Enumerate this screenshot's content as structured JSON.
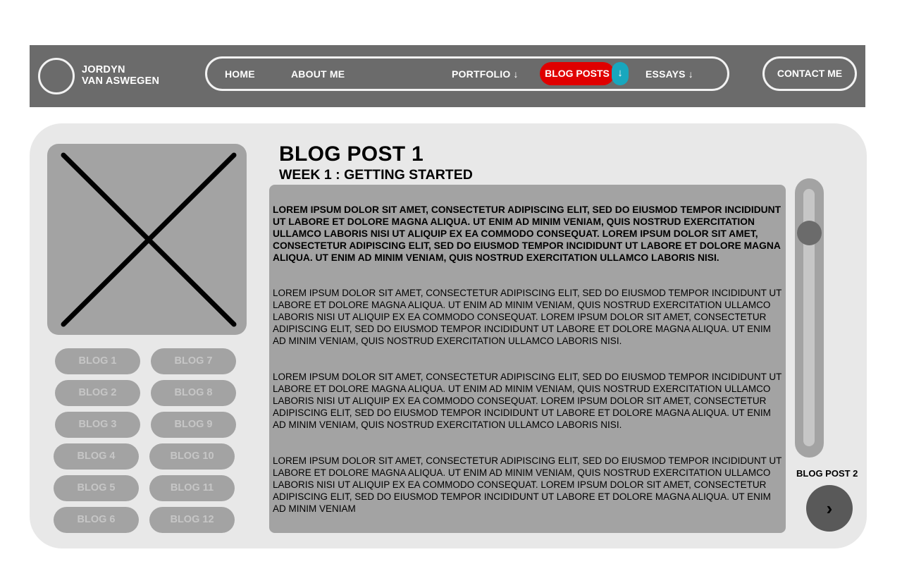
{
  "brand": {
    "line1": "JORDYN",
    "line2": "VAN ASWEGEN"
  },
  "nav": {
    "home": "HOME",
    "about": "ABOUT ME",
    "portfolio": "PORTFOLIO ↓",
    "blog_posts": "BLOG POSTS",
    "blog_posts_arrow": "↓",
    "essays": "ESSAYS ↓",
    "contact": "CONTACT ME"
  },
  "colors": {
    "nav_bg": "#6b6b6b",
    "active_nav": "#e00000",
    "active_arrow": "#18a7be",
    "card_bg": "#e8e8e8",
    "panel_bg": "#a3a3a3"
  },
  "icons": {
    "image_placeholder": "image-placeholder-icon",
    "next": "chevron-right-icon"
  },
  "sidebar": {
    "blogs": [
      "BLOG 1",
      "BLOG 2",
      "BLOG 3",
      "BLOG 4",
      "BLOG 5",
      "BLOG 6",
      "BLOG 7",
      "BLOG 8",
      "BLOG 9",
      "BLOG 10",
      "BLOG 11",
      "BLOG 12"
    ]
  },
  "post": {
    "title": "BLOG POST 1",
    "subtitle": "WEEK 1 : GETTING STARTED",
    "paragraphs": [
      "LOREM IPSUM DOLOR SIT AMET, CONSECTETUR ADIPISCING ELIT, SED DO EIUSMOD TEMPOR INCIDIDUNT UT LABORE ET DOLORE MAGNA ALIQUA. UT ENIM AD MINIM VENIAM, QUIS NOSTRUD EXERCITATION ULLAMCO LABORIS NISI UT ALIQUIP EX EA COMMODO CONSEQUAT. LOREM IPSUM DOLOR SIT AMET, CONSECTETUR ADIPISCING ELIT, SED DO EIUSMOD TEMPOR INCIDIDUNT UT LABORE ET DOLORE MAGNA ALIQUA. UT ENIM AD MINIM VENIAM, QUIS NOSTRUD EXERCITATION ULLAMCO LABORIS NISI.",
      "LOREM IPSUM DOLOR SIT AMET, CONSECTETUR ADIPISCING ELIT, SED DO EIUSMOD TEMPOR INCIDIDUNT UT LABORE ET DOLORE MAGNA ALIQUA. UT ENIM AD MINIM VENIAM, QUIS NOSTRUD EXERCITATION ULLAMCO LABORIS NISI UT ALIQUIP EX EA COMMODO CONSEQUAT. LOREM IPSUM DOLOR SIT AMET, CONSECTETUR ADIPISCING ELIT, SED DO EIUSMOD TEMPOR INCIDIDUNT UT LABORE ET DOLORE MAGNA ALIQUA. UT ENIM AD MINIM VENIAM, QUIS NOSTRUD EXERCITATION ULLAMCO LABORIS NISI.",
      "LOREM IPSUM DOLOR SIT AMET, CONSECTETUR ADIPISCING ELIT, SED DO EIUSMOD TEMPOR INCIDIDUNT UT LABORE ET DOLORE MAGNA ALIQUA. UT ENIM AD MINIM VENIAM, QUIS NOSTRUD EXERCITATION ULLAMCO LABORIS NISI UT ALIQUIP EX EA COMMODO CONSEQUAT. LOREM IPSUM DOLOR SIT AMET, CONSECTETUR ADIPISCING ELIT, SED DO EIUSMOD TEMPOR INCIDIDUNT UT LABORE ET DOLORE MAGNA ALIQUA. UT ENIM AD MINIM VENIAM, QUIS NOSTRUD EXERCITATION ULLAMCO LABORIS NISI.",
      "LOREM IPSUM DOLOR SIT AMET, CONSECTETUR ADIPISCING ELIT, SED DO EIUSMOD TEMPOR INCIDIDUNT UT LABORE ET DOLORE MAGNA ALIQUA. UT ENIM AD MINIM VENIAM, QUIS NOSTRUD EXERCITATION ULLAMCO LABORIS NISI UT ALIQUIP EX EA COMMODO CONSEQUAT. LOREM IPSUM DOLOR SIT AMET, CONSECTETUR ADIPISCING ELIT, SED DO EIUSMOD TEMPOR INCIDIDUNT UT LABORE ET DOLORE MAGNA ALIQUA. UT ENIM AD MINIM VENIAM"
    ]
  },
  "next": {
    "label": "BLOG POST 2",
    "icon_glyph": "›"
  }
}
